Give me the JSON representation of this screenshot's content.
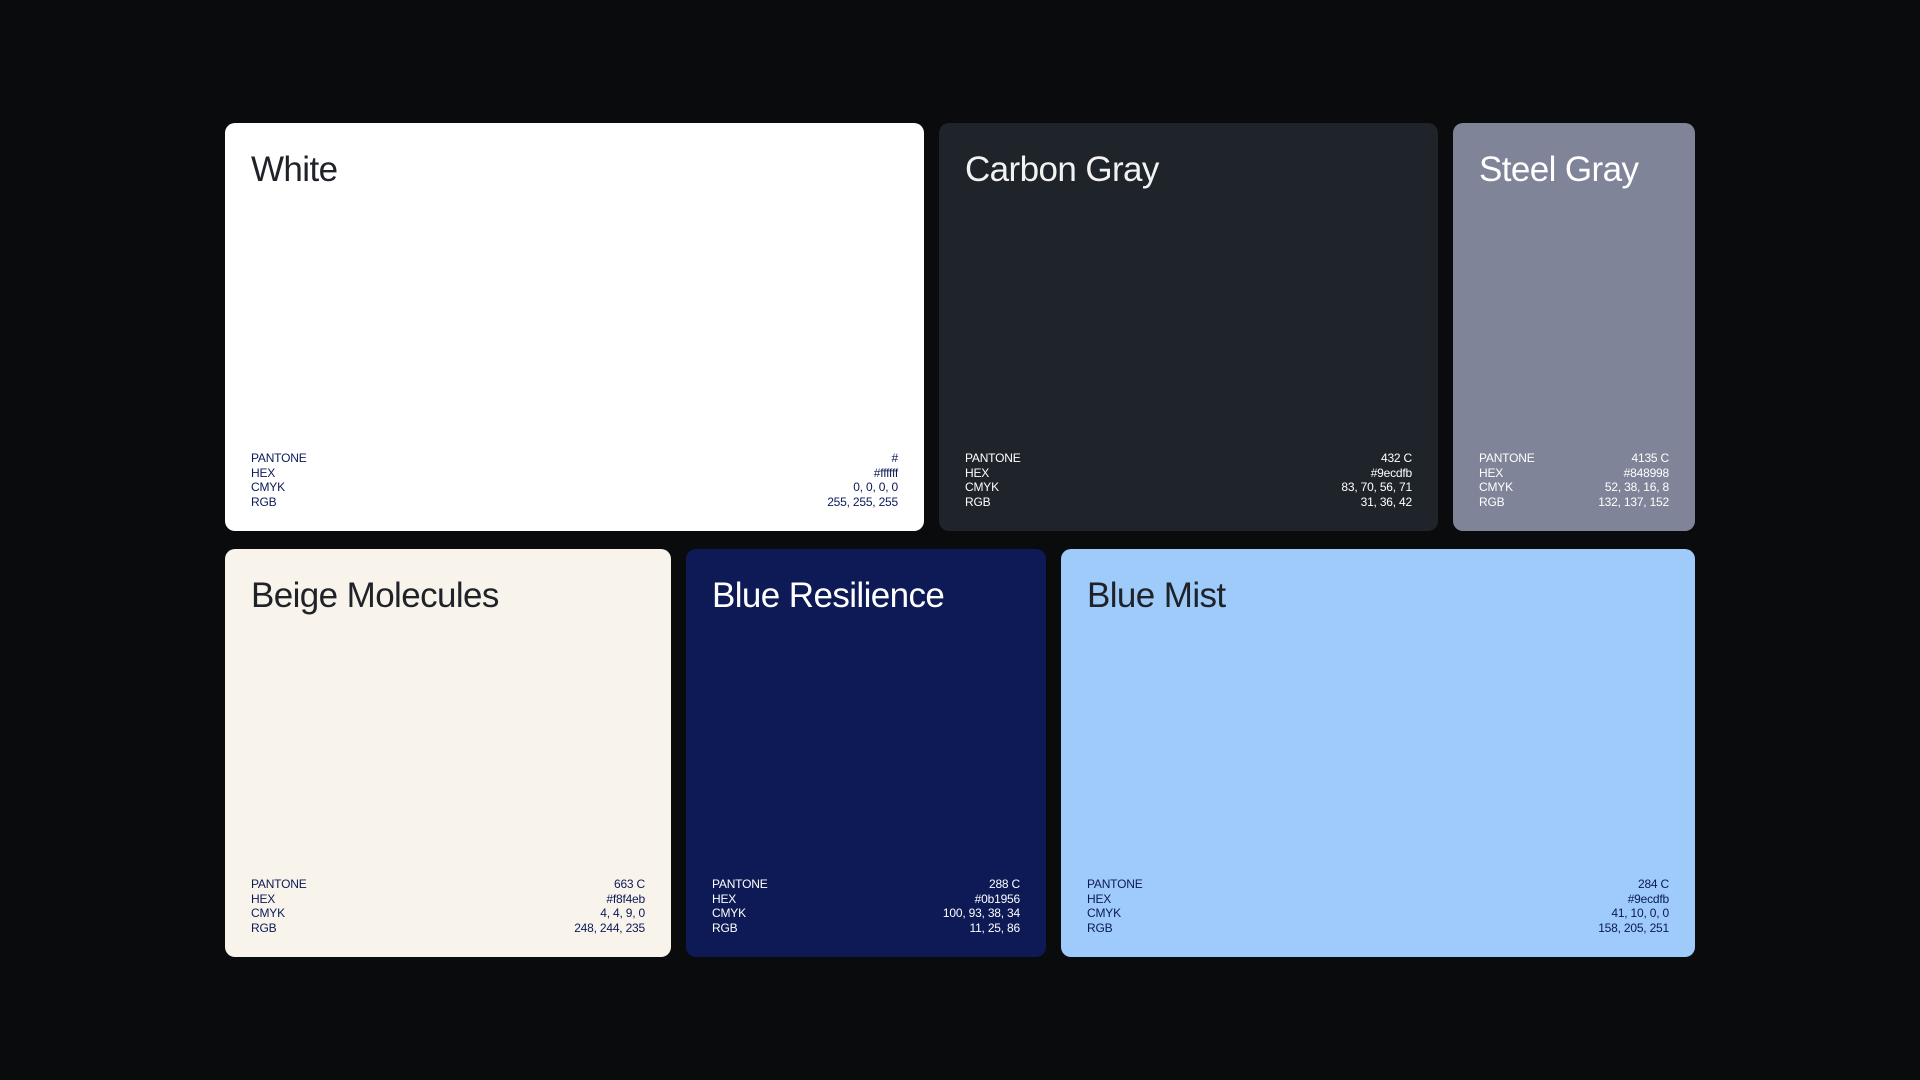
{
  "spec_labels": {
    "pantone": "PANTONE",
    "hex": "HEX",
    "cmyk": "CMYK",
    "rgb": "RGB"
  },
  "swatches": [
    {
      "name": "White",
      "pantone": "#",
      "hex": "#ffffff",
      "cmyk": "0, 0, 0, 0",
      "rgb": "255, 255, 255",
      "background": "#ffffff",
      "title_color": "#1f2229",
      "spec_color": "#0b1956"
    },
    {
      "name": "Carbon Gray",
      "pantone": "432 C",
      "hex": "#9ecdfb",
      "cmyk": "83, 70, 56, 71",
      "rgb": "31, 36, 42",
      "background": "#1f242a",
      "title_color": "#f2f2f2",
      "spec_color": "#ffffff"
    },
    {
      "name": "Steel Gray",
      "pantone": "4135 C",
      "hex": "#848998",
      "cmyk": "52, 38, 16, 8",
      "rgb": "132, 137, 152",
      "background": "#7f8498",
      "title_color": "#ffffff",
      "spec_color": "#ffffff"
    },
    {
      "name": "Beige Molecules",
      "pantone": "663 C",
      "hex": "#f8f4eb",
      "cmyk": "4, 4, 9, 0",
      "rgb": "248, 244, 235",
      "background": "#f8f4eb",
      "title_color": "#1f2229",
      "spec_color": "#0b1956"
    },
    {
      "name": "Blue Resilience",
      "pantone": "288 C",
      "hex": "#0b1956",
      "cmyk": "100, 93, 38, 34",
      "rgb": "11, 25, 86",
      "background": "#0d1a56",
      "title_color": "#ffffff",
      "spec_color": "#ffffff"
    },
    {
      "name": "Blue Mist",
      "pantone": "284 C",
      "hex": "#9ecdfb",
      "cmyk": "41, 10, 0, 0",
      "rgb": "158, 205, 251",
      "background": "#9ecbfa",
      "title_color": "#1f2229",
      "spec_color": "#0b1956"
    }
  ]
}
